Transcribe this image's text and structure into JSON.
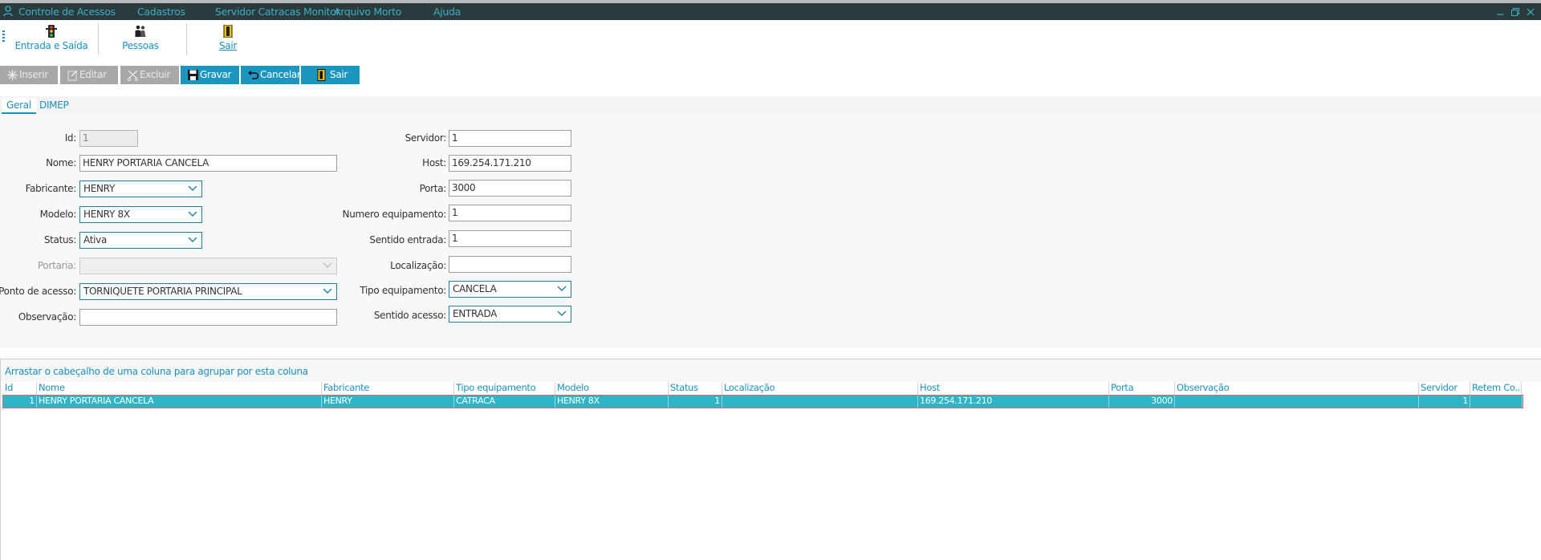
{
  "menu": {
    "items": [
      "Controle de Acessos",
      "Cadastros",
      "Servidor Catracas Monitor",
      "Arquivo Morto",
      "Ajuda"
    ]
  },
  "toolbar": {
    "entrada_saida": "Entrada e Saída",
    "pessoas": "Pessoas",
    "sair": "Sair"
  },
  "actions": {
    "inserir": "Inserir",
    "editar": "Editar",
    "excluir": "Excluir",
    "gravar": "Gravar",
    "cancelar": "Cancelar",
    "sair": "Sair"
  },
  "tabs": [
    "Geral",
    "DIMEP"
  ],
  "form": {
    "left": {
      "id_label": "Id:",
      "id_value": "1",
      "nome_label": "Nome:",
      "nome_value": "HENRY PORTARIA CANCELA",
      "fabricante_label": "Fabricante:",
      "fabricante_value": "HENRY",
      "modelo_label": "Modelo:",
      "modelo_value": "HENRY 8X",
      "status_label": "Status:",
      "status_value": "Ativa",
      "portaria_label": "Portaria:",
      "portaria_value": "",
      "ponto_label": "Ponto de acesso:",
      "ponto_value": "TORNIQUETE PORTARIA PRINCIPAL",
      "obs_label": "Observação:",
      "obs_value": ""
    },
    "right": {
      "servidor_label": "Servidor:",
      "servidor_value": "1",
      "host_label": "Host:",
      "host_value": "169.254.171.210",
      "porta_label": "Porta:",
      "porta_value": "3000",
      "numero_label": "Numero equipamento:",
      "numero_value": "1",
      "sentido_entrada_label": "Sentido entrada:",
      "sentido_entrada_value": "1",
      "localizacao_label": "Localização:",
      "localizacao_value": "",
      "tipo_label": "Tipo equipamento:",
      "tipo_value": "CANCELA",
      "sentido_acesso_label": "Sentido acesso:",
      "sentido_acesso_value": "ENTRADA"
    }
  },
  "grid": {
    "group_hint": "Arrastar o cabeçalho de uma coluna para agrupar por esta coluna",
    "columns": [
      "Id",
      "Nome",
      "Fabricante",
      "Tipo equipamento",
      "Modelo",
      "Status",
      "Localização",
      "Host",
      "Porta",
      "Observação",
      "Servidor",
      "Retem Co..."
    ],
    "rows": [
      [
        "1",
        "HENRY PORTARIA CANCELA",
        "HENRY",
        "CATRACA",
        "HENRY 8X",
        "1",
        "",
        "169.254.171.210",
        "3000",
        "",
        "1",
        ""
      ]
    ]
  },
  "colors": {
    "accent": "#1d96bf",
    "menubar": "#2b3a3d",
    "selected_row": "#2eb6c8"
  }
}
